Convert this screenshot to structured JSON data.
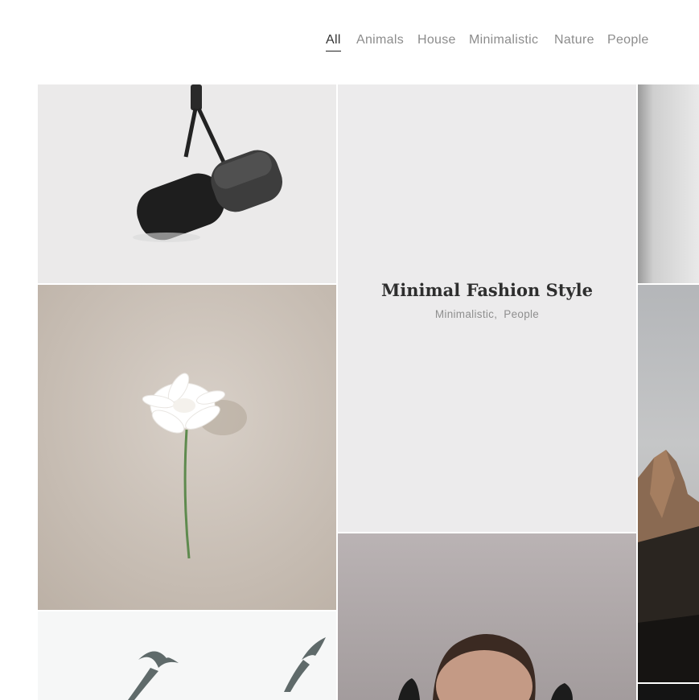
{
  "filters": [
    {
      "label": "All",
      "active": true
    },
    {
      "label": "Animals",
      "active": false
    },
    {
      "label": "House",
      "active": false
    },
    {
      "label": "Minimalistic",
      "active": false
    },
    {
      "label": "Nature",
      "active": false
    },
    {
      "label": "People",
      "active": false
    }
  ],
  "portfolio": {
    "hovered_item": {
      "title": "Minimal Fashion Style",
      "categories": [
        "Minimalistic",
        "People"
      ],
      "separator": ","
    }
  },
  "colors": {
    "text_dark": "#2e2e2e",
    "text_muted": "#8c8c8c",
    "overlay_bg": "#ecebec"
  }
}
